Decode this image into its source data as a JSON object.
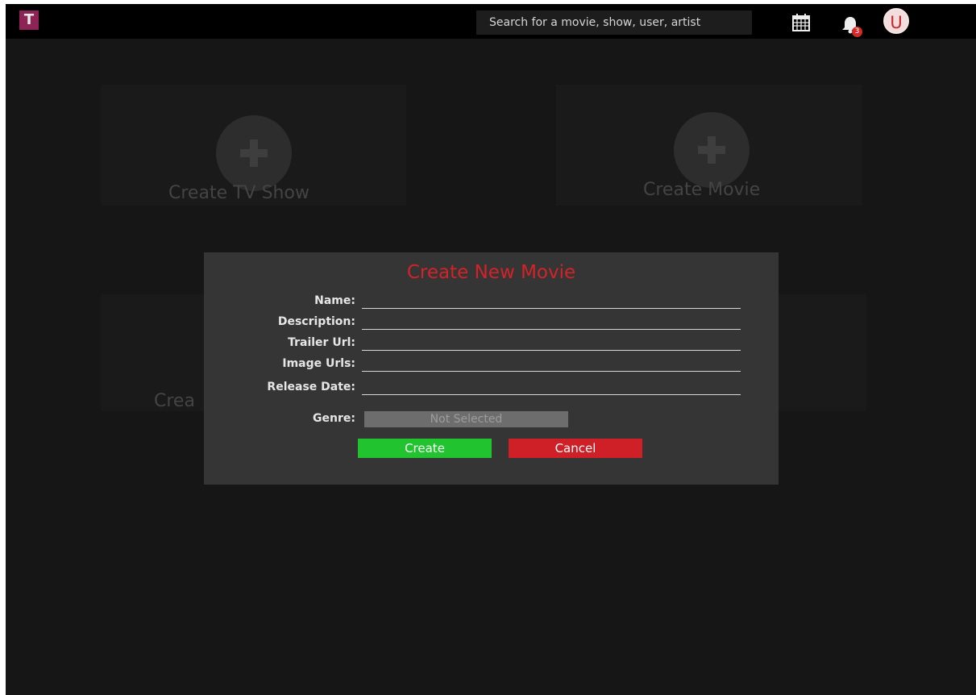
{
  "topbar": {
    "logo_letter": "T",
    "search_placeholder": "Search for a movie, show, user, artist",
    "notification_count": "3",
    "avatar_letter": "U"
  },
  "cards": {
    "tv_show_label": "Create TV Show",
    "movie_label": "Create Movie",
    "partial_label": "Crea"
  },
  "modal": {
    "title": "Create New Movie",
    "fields": {
      "name_label": "Name:",
      "description_label": "Description:",
      "trailer_url_label": "Trailer Url:",
      "image_urls_label": "Image Urls:",
      "release_date_label": "Release Date:",
      "genre_label": "Genre:"
    },
    "genre_value": "Not Selected",
    "create_label": "Create",
    "cancel_label": "Cancel"
  },
  "colors": {
    "title": "#d32329",
    "create_button": "#21c42f",
    "cancel_button": "#cf2027",
    "logo": "#8e2356"
  }
}
